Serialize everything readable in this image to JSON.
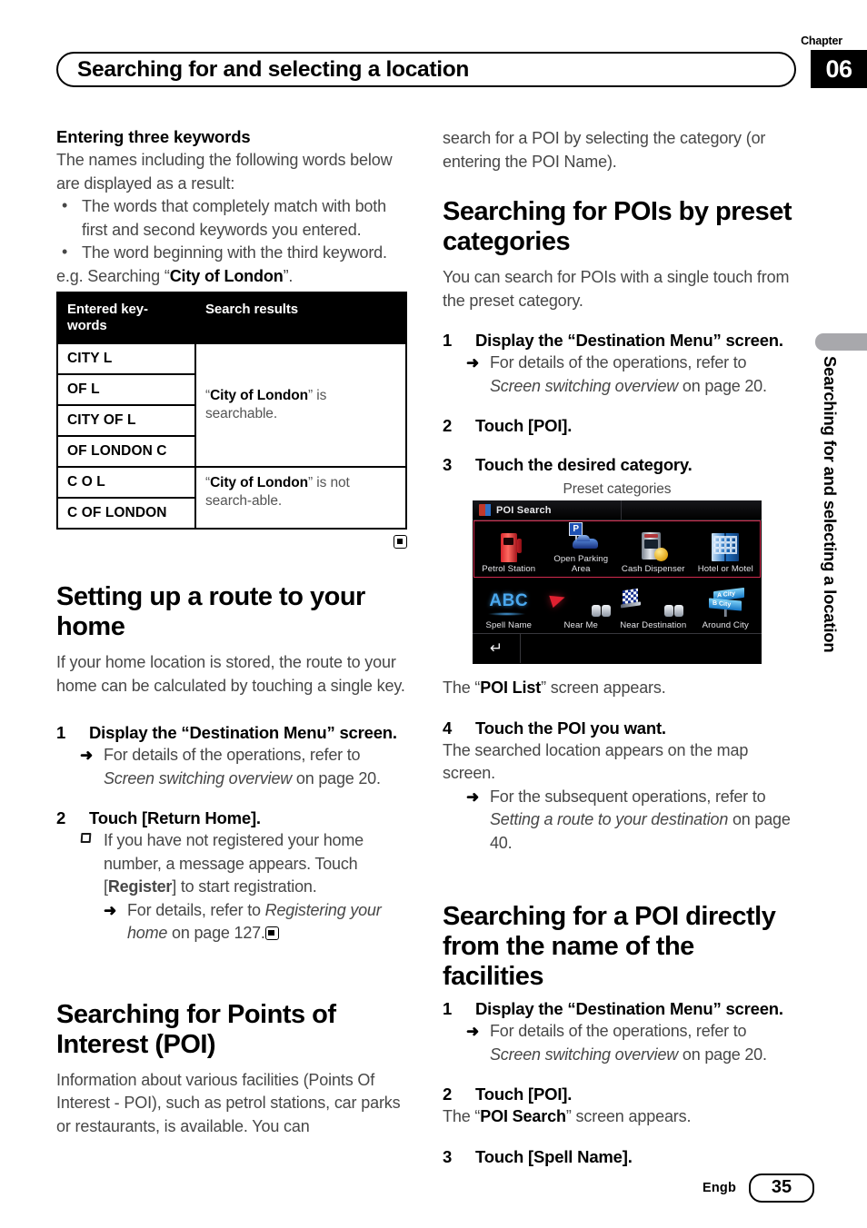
{
  "header": {
    "chapter_label": "Chapter",
    "chapter_number": "06",
    "title": "Searching for and selecting a location"
  },
  "side_tab": {
    "text": "Searching for and selecting a location"
  },
  "left_column": {
    "subhead": "Entering three keywords",
    "intro": "The names including the following words below are displayed as a result:",
    "bullets": [
      "The words that completely match with both first and second keywords you entered.",
      "The word beginning with the third keyword."
    ],
    "example_prefix": "e.g. Searching “",
    "example_bold": "City of London",
    "example_suffix": "”.",
    "table": {
      "headers": [
        "Entered key-words",
        "Search results"
      ],
      "group1_keywords": [
        "CITY L",
        "OF L",
        "CITY OF L",
        "OF LONDON C"
      ],
      "group1_result_quote": "City of London",
      "group1_result_text": "” is searchable.",
      "group2_keywords": [
        "C O L",
        "C OF LONDON"
      ],
      "group2_result_quote": "City of London",
      "group2_result_text": "” is not search-able."
    },
    "heading_home": "Setting up a route to your home",
    "home_intro": "If your home location is stored, the route to your home can be calculated by touching a single key.",
    "home_step1_num": "1",
    "home_step1_text": "Display the “Destination Menu” screen.",
    "home_step1_note_a": "For details of the operations, refer to ",
    "home_step1_note_ital": "Screen switching overview",
    "home_step1_note_b": " on page 20.",
    "home_step2_num": "2",
    "home_step2_text": "Touch [Return Home].",
    "home_step2_note_a": "If you have not registered your home number, a message appears. Touch [",
    "home_step2_note_bold": "Register",
    "home_step2_note_b": "] to start registration.",
    "home_step2_subnote_a": "For details, refer to ",
    "home_step2_subnote_ital": "Registering your home",
    "home_step2_subnote_b": " on page 127.",
    "heading_poi": "Searching for Points of Interest (POI)",
    "poi_intro": "Information about various facilities (Points Of Interest - POI), such as petrol stations, car parks or restaurants, is available. You can"
  },
  "right_column": {
    "continued_text": "search for a POI by selecting the category (or entering the POI Name).",
    "heading_preset": "Searching for POIs by preset categories",
    "preset_intro": "You can search for POIs with a single touch from the preset category.",
    "preset_step1_num": "1",
    "preset_step1_text": "Display the “Destination Menu” screen.",
    "preset_step1_note_a": "For details of the operations, refer to ",
    "preset_step1_note_ital": "Screen switching overview",
    "preset_step1_note_b": " on page 20.",
    "preset_step2_num": "2",
    "preset_step2_text": "Touch [POI].",
    "preset_step3_num": "3",
    "preset_step3_text": "Touch the desired category.",
    "device": {
      "caption": "Preset categories",
      "titlebar_text": "POI Search",
      "titlebar_icon": "poi-search-icon",
      "row1": [
        {
          "label": "Petrol Station",
          "icon": "petrol-pump-icon"
        },
        {
          "label": "Open Parking Area",
          "icon": "parking-sign-car-icon"
        },
        {
          "label": "Cash Dispenser",
          "icon": "atm-coin-icon"
        },
        {
          "label": "Hotel or Motel",
          "icon": "hotel-building-icon"
        }
      ],
      "row2": [
        {
          "label": "Spell Name",
          "icon": "abc-icon"
        },
        {
          "label": "Near Me",
          "icon": "red-arrow-binoculars-icon"
        },
        {
          "label": "Near Destination",
          "icon": "checkered-flag-binoculars-icon"
        },
        {
          "label": "Around City",
          "icon": "signpost-icon"
        }
      ],
      "back_icon": "back-arrow-icon",
      "highlight_color": "#d12a4e"
    },
    "poi_list_text_a": "The “",
    "poi_list_bold": "POI List",
    "poi_list_text_b": "” screen appears.",
    "step4_num": "4",
    "step4_text": "Touch the POI you want.",
    "step4_body": "The searched location appears on the map screen.",
    "step4_note_a": "For the subsequent operations, refer to ",
    "step4_note_ital": "Setting a route to your destination",
    "step4_note_b": " on page 40.",
    "heading_direct": "Searching for a POI directly from the name of the facilities",
    "direct_step1_num": "1",
    "direct_step1_text": "Display the “Destination Menu” screen.",
    "direct_step1_note_a": "For details of the operations, refer to ",
    "direct_step1_note_ital": "Screen switching overview",
    "direct_step1_note_b": " on page 20.",
    "direct_step2_num": "2",
    "direct_step2_text": "Touch [POI].",
    "direct_step2_body_a": "The “",
    "direct_step2_body_bold": "POI Search",
    "direct_step2_body_b": "” screen appears.",
    "direct_step3_num": "3",
    "direct_step3_text": "Touch [Spell Name]."
  },
  "footer": {
    "language": "Engb",
    "page_number": "35"
  }
}
